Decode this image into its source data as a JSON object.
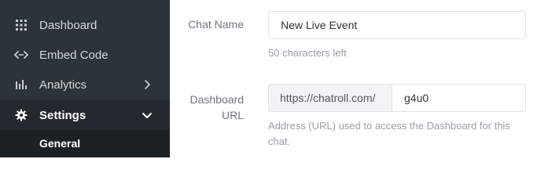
{
  "sidebar": {
    "items": [
      {
        "label": "Dashboard",
        "icon": "grid-icon"
      },
      {
        "label": "Embed Code",
        "icon": "code-icon"
      },
      {
        "label": "Analytics",
        "icon": "bar-chart-icon"
      },
      {
        "label": "Settings",
        "icon": "gear-icon"
      }
    ],
    "sub_items": [
      {
        "label": "General"
      }
    ]
  },
  "form": {
    "chat_name": {
      "label": "Chat Name",
      "value": "New Live Event",
      "help": "50 characters left"
    },
    "dashboard_url": {
      "label_line1": "Dashboard",
      "label_line2": "URL",
      "prefix": "https://chatroll.com/",
      "value": "g4u0",
      "help_line1": "Address (URL) used to access the Dashboard for this",
      "help_line2": "chat."
    }
  },
  "colors": {
    "sidebar_bg": "#2c3339",
    "sidebar_active_bg": "#23292e",
    "subnav_bg": "#1c2125",
    "label_text": "#6f767c",
    "help_text": "#9aa0a5",
    "input_border": "#dfe3e6",
    "addon_bg": "#f1f3f5"
  }
}
